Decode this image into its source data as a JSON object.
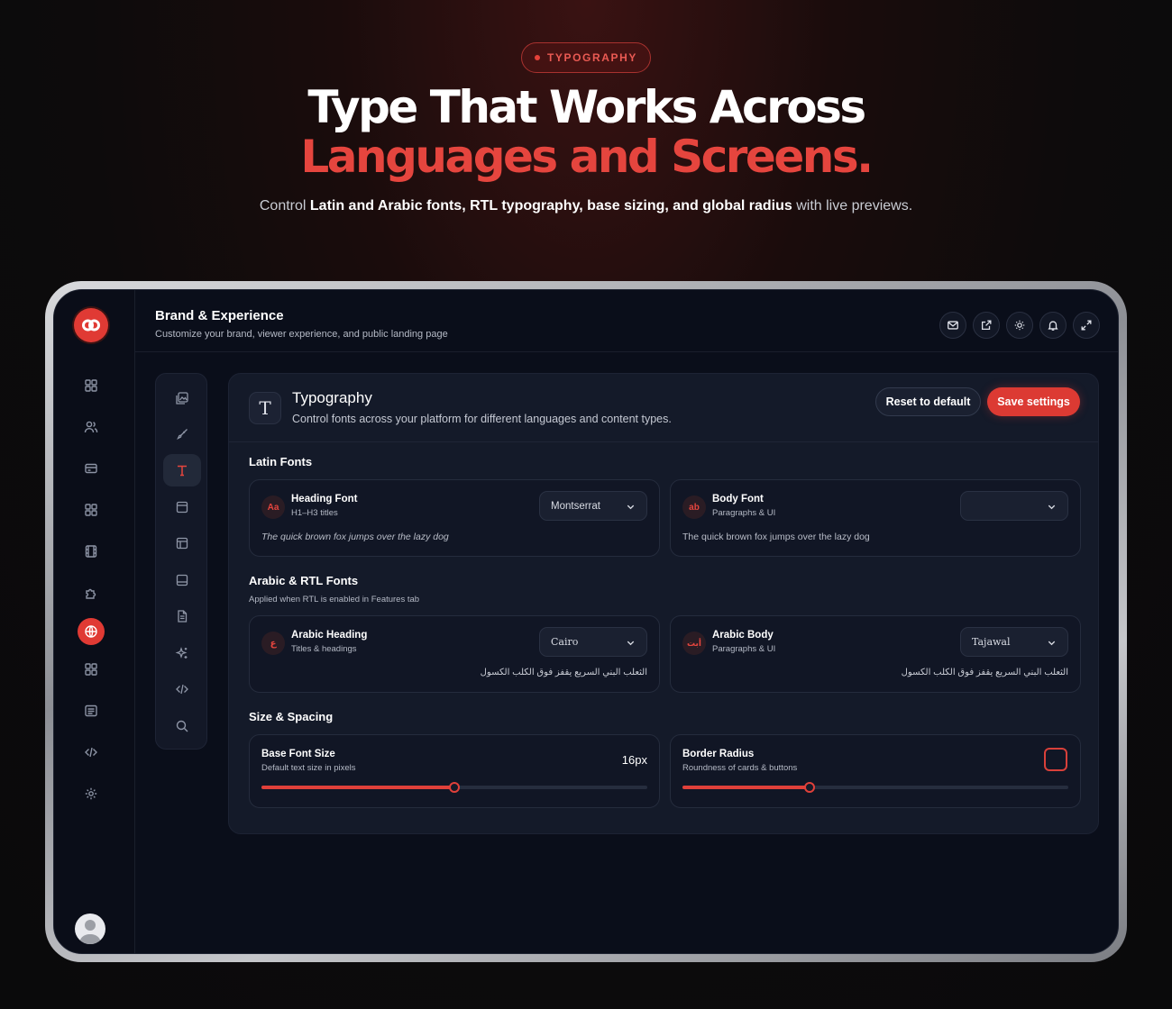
{
  "hero": {
    "pill": "TYPOGRAPHY",
    "headline_line1": "Type That Works Across",
    "headline_line2": "Languages and Screens.",
    "sub_prefix": "Control ",
    "sub_bold": "Latin and Arabic fonts, RTL typography, base sizing, and global radius",
    "sub_suffix": " with live previews."
  },
  "colors": {
    "accent": "#e03a34",
    "panel": "#141a29",
    "background": "#0a0e1a"
  },
  "rail": {
    "items": [
      {
        "icon": "dashboard-grid-icon"
      },
      {
        "icon": "users-icon"
      },
      {
        "icon": "card-icon"
      },
      {
        "icon": "apps-grid-icon"
      },
      {
        "icon": "film-icon"
      },
      {
        "icon": "puzzle-icon"
      },
      {
        "icon": "globe-icon",
        "active": true
      },
      {
        "icon": "grid-icon"
      },
      {
        "icon": "list-icon"
      },
      {
        "icon": "code-icon"
      },
      {
        "icon": "settings-icon"
      }
    ]
  },
  "header": {
    "title": "Brand & Experience",
    "subtitle": "Customize your brand, viewer experience, and public landing page",
    "actions": [
      "mail-icon",
      "external-link-icon",
      "sun-icon",
      "bell-icon",
      "expand-icon"
    ]
  },
  "subnav": {
    "items": [
      "images-icon",
      "brush-icon",
      "type-icon",
      "layout-icon",
      "sidebar-layout-icon",
      "footer-layout-icon",
      "document-icon",
      "sparkles-icon",
      "code-icon",
      "search-icon"
    ],
    "active": "type-icon"
  },
  "panel": {
    "title": "Typography",
    "subtitle": "Control fonts across your platform for different languages and content types.",
    "reset_label": "Reset to default",
    "save_label": "Save settings",
    "latin": {
      "title": "Latin Fonts",
      "heading": {
        "badge": "Aa",
        "name": "Heading Font",
        "desc": "H1–H3 titles",
        "value": "Montserrat",
        "preview": "The quick brown fox jumps over the lazy dog"
      },
      "body": {
        "badge": "ab",
        "name": "Body Font",
        "desc": "Paragraphs & UI",
        "value": "",
        "preview": "The quick brown fox jumps over the lazy dog"
      }
    },
    "arabic": {
      "title": "Arabic & RTL Fonts",
      "note": "Applied when RTL is enabled in Features tab",
      "heading": {
        "badge": "ع",
        "name": "Arabic Heading",
        "desc": "Titles & headings",
        "value": "Cairo",
        "preview": "الثعلب البني السريع يقفز فوق الكلب الكسول"
      },
      "body": {
        "badge": "أبت",
        "name": "Arabic Body",
        "desc": "Paragraphs & UI",
        "value": "Tajawal",
        "preview": "الثعلب البني السريع يقفز فوق الكلب الكسول"
      }
    },
    "size": {
      "title": "Size & Spacing",
      "base": {
        "name": "Base Font Size",
        "desc": "Default text size in pixels",
        "value": "16px",
        "slider_fraction": 0.5
      },
      "radius": {
        "name": "Border Radius",
        "desc": "Roundness of cards & buttons",
        "slider_fraction": 0.33
      }
    }
  }
}
